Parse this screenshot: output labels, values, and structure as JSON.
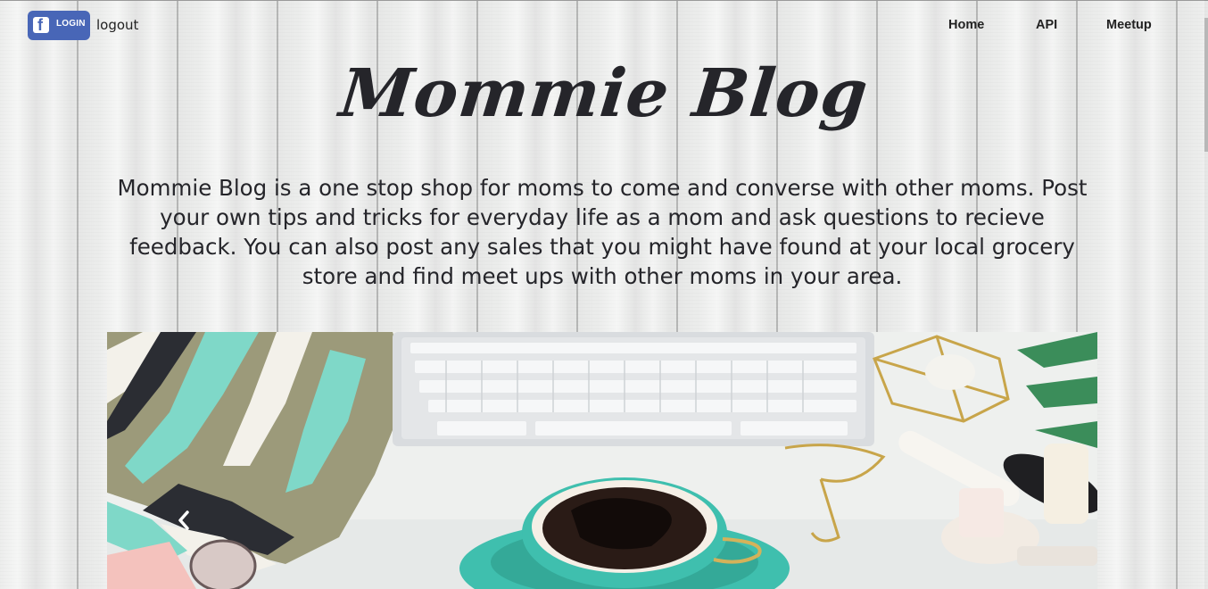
{
  "header": {
    "login_label": "LOGIN",
    "logout_label": "logout",
    "nav": [
      {
        "label": "Home"
      },
      {
        "label": "API"
      },
      {
        "label": "Meetup"
      }
    ]
  },
  "hero": {
    "title": "Mommie Blog",
    "description": "Mommie Blog is a one stop shop for moms to come and converse with other moms. Post your own tips and tricks for everyday life as a mom and ask questions to recieve feedback. You can also post any sales that you might have found at your local grocery store and find meet ups with other moms in your area."
  },
  "carousel": {
    "prev_icon": "chevron-left-icon"
  },
  "colors": {
    "facebook_blue": "#4866b7",
    "text_dark": "#25252a",
    "teal_accent": "#3fbfae"
  }
}
